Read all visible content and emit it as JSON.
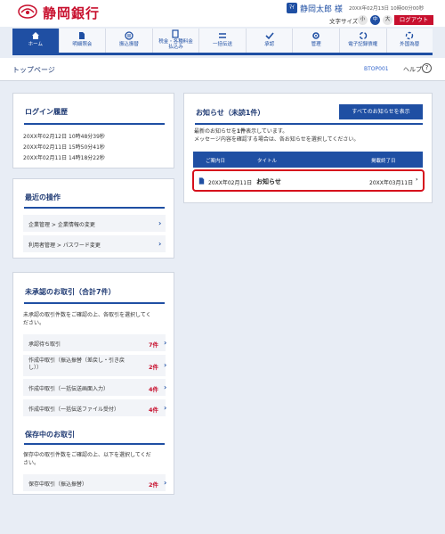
{
  "header": {
    "bank_name": "静岡銀行",
    "user_badge": "ﾏｲ",
    "user_name": "静岡太郎 様",
    "last_login": "20XX年02月13日 10時00分00秒",
    "text_size_label": "文字サイズ",
    "text_size_small": "小",
    "text_size_mid": "中",
    "text_size_large": "大",
    "logout": "ログアウト",
    "brand_color": "#c8102e",
    "accent_color": "#1f4fa3"
  },
  "nav": {
    "items": [
      {
        "label": "ホーム",
        "icon": "home-icon"
      },
      {
        "label": "明細照会",
        "icon": "document-icon"
      },
      {
        "label": "振込振替",
        "icon": "transfer-icon"
      },
      {
        "label": "税金・各種料金払込み",
        "line1": "税金・各種料金",
        "line2": "払込み",
        "icon": "tax-icon"
      },
      {
        "label": "一括伝送",
        "icon": "batch-icon"
      },
      {
        "label": "承認",
        "icon": "approve-icon"
      },
      {
        "label": "管理",
        "icon": "gear-icon"
      },
      {
        "label": "電子記録債権",
        "icon": "electronic-icon"
      },
      {
        "label": "外国為替",
        "icon": "forex-icon"
      }
    ]
  },
  "page": {
    "title": "トップページ",
    "id": "BTOP001",
    "help": "ヘルプ",
    "help_icon": "?"
  },
  "login_history": {
    "title": "ログイン履歴",
    "entries": [
      "20XX年02月12日 10時48分39秒",
      "20XX年02月11日 15時50分41秒",
      "20XX年02月11日 14時18分22秒"
    ]
  },
  "recent_ops": {
    "title": "最近の操作",
    "items": [
      "企業管理 > 企業情報の変更",
      "利用者管理 > パスワード変更"
    ]
  },
  "pending": {
    "title": "未承認のお取引（合計7件）",
    "desc1": "未承認の取引件数をご確認の上、各取引を選択してく",
    "desc2": "ださい。",
    "items": [
      {
        "label": "承認待ち取引",
        "count": "7件"
      },
      {
        "label": "作成中取引（振込振替（差戻し・引き戻し））",
        "line1": "作成中取引（振込振替（差戻し・引き戻",
        "line2": "し））",
        "count": "2件"
      },
      {
        "label": "作成中取引（一括伝送画面入力）",
        "count": "4件"
      },
      {
        "label": "作成中取引（一括伝送ファイル受付）",
        "count": "4件"
      }
    ]
  },
  "saved": {
    "title": "保存中のお取引",
    "desc1": "保存中の取引件数をご確認の上、以下を選択してくだ",
    "desc2": "さい。",
    "items": [
      {
        "label": "保存中取引（振込振替）",
        "count": "2件"
      }
    ]
  },
  "notices": {
    "title": "お知らせ（未読1件）",
    "show_all": "すべてのお知らせを表示",
    "desc1_pre": "最新のお知らせを",
    "desc1_count": "1件",
    "desc1_post": "表示しています。",
    "desc2": "メッセージ内容を確認する場合は、各お知らせを選択してください。",
    "columns": [
      "ご案内日",
      "タイトル",
      "掲載終了日"
    ],
    "rows": [
      {
        "date": "20XX年02月11日",
        "title": "お知らせ",
        "end": "20XX年03月11日"
      }
    ]
  }
}
